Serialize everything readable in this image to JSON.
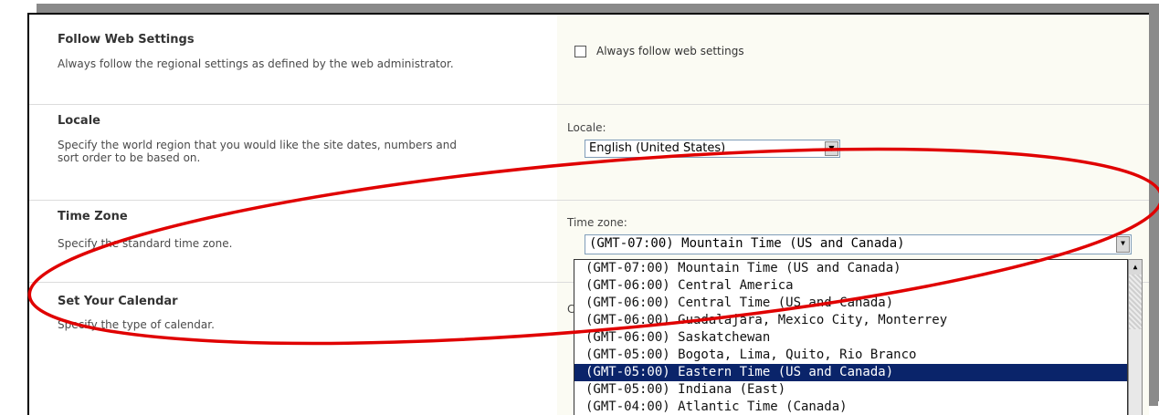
{
  "follow": {
    "title": "Follow Web Settings",
    "desc": "Always follow the regional settings as defined by the web administrator.",
    "checkbox_label": "Always follow web settings"
  },
  "locale": {
    "title": "Locale",
    "desc_line1": "Specify the world region that you would like the site dates, numbers and",
    "desc_line2": "sort order to be based on.",
    "field_label": "Locale:",
    "selected": "English (United States)"
  },
  "timezone": {
    "title": "Time Zone",
    "desc": "Specify the standard time zone.",
    "field_label": "Time zone:",
    "selected": "(GMT-07:00) Mountain Time (US and Canada)",
    "options": [
      "(GMT-07:00) Mountain Time (US and Canada)",
      "(GMT-06:00) Central America",
      "(GMT-06:00) Central Time (US and Canada)",
      "(GMT-06:00) Guadalajara, Mexico City, Monterrey",
      "(GMT-06:00) Saskatchewan",
      "(GMT-05:00) Bogota, Lima, Quito, Rio Branco",
      "(GMT-05:00) Eastern Time (US and Canada)",
      "(GMT-05:00) Indiana (East)",
      "(GMT-04:00) Atlantic Time (Canada)"
    ],
    "highlighted_index": 6
  },
  "calendar": {
    "title": "Set Your Calendar",
    "desc": "Specify the type of calendar.",
    "field_label_partial": "Ca"
  },
  "colors": {
    "annotation_ellipse": "#e00000",
    "highlight": "#0a246a",
    "right_panel_bg": "#fbfbf3"
  }
}
